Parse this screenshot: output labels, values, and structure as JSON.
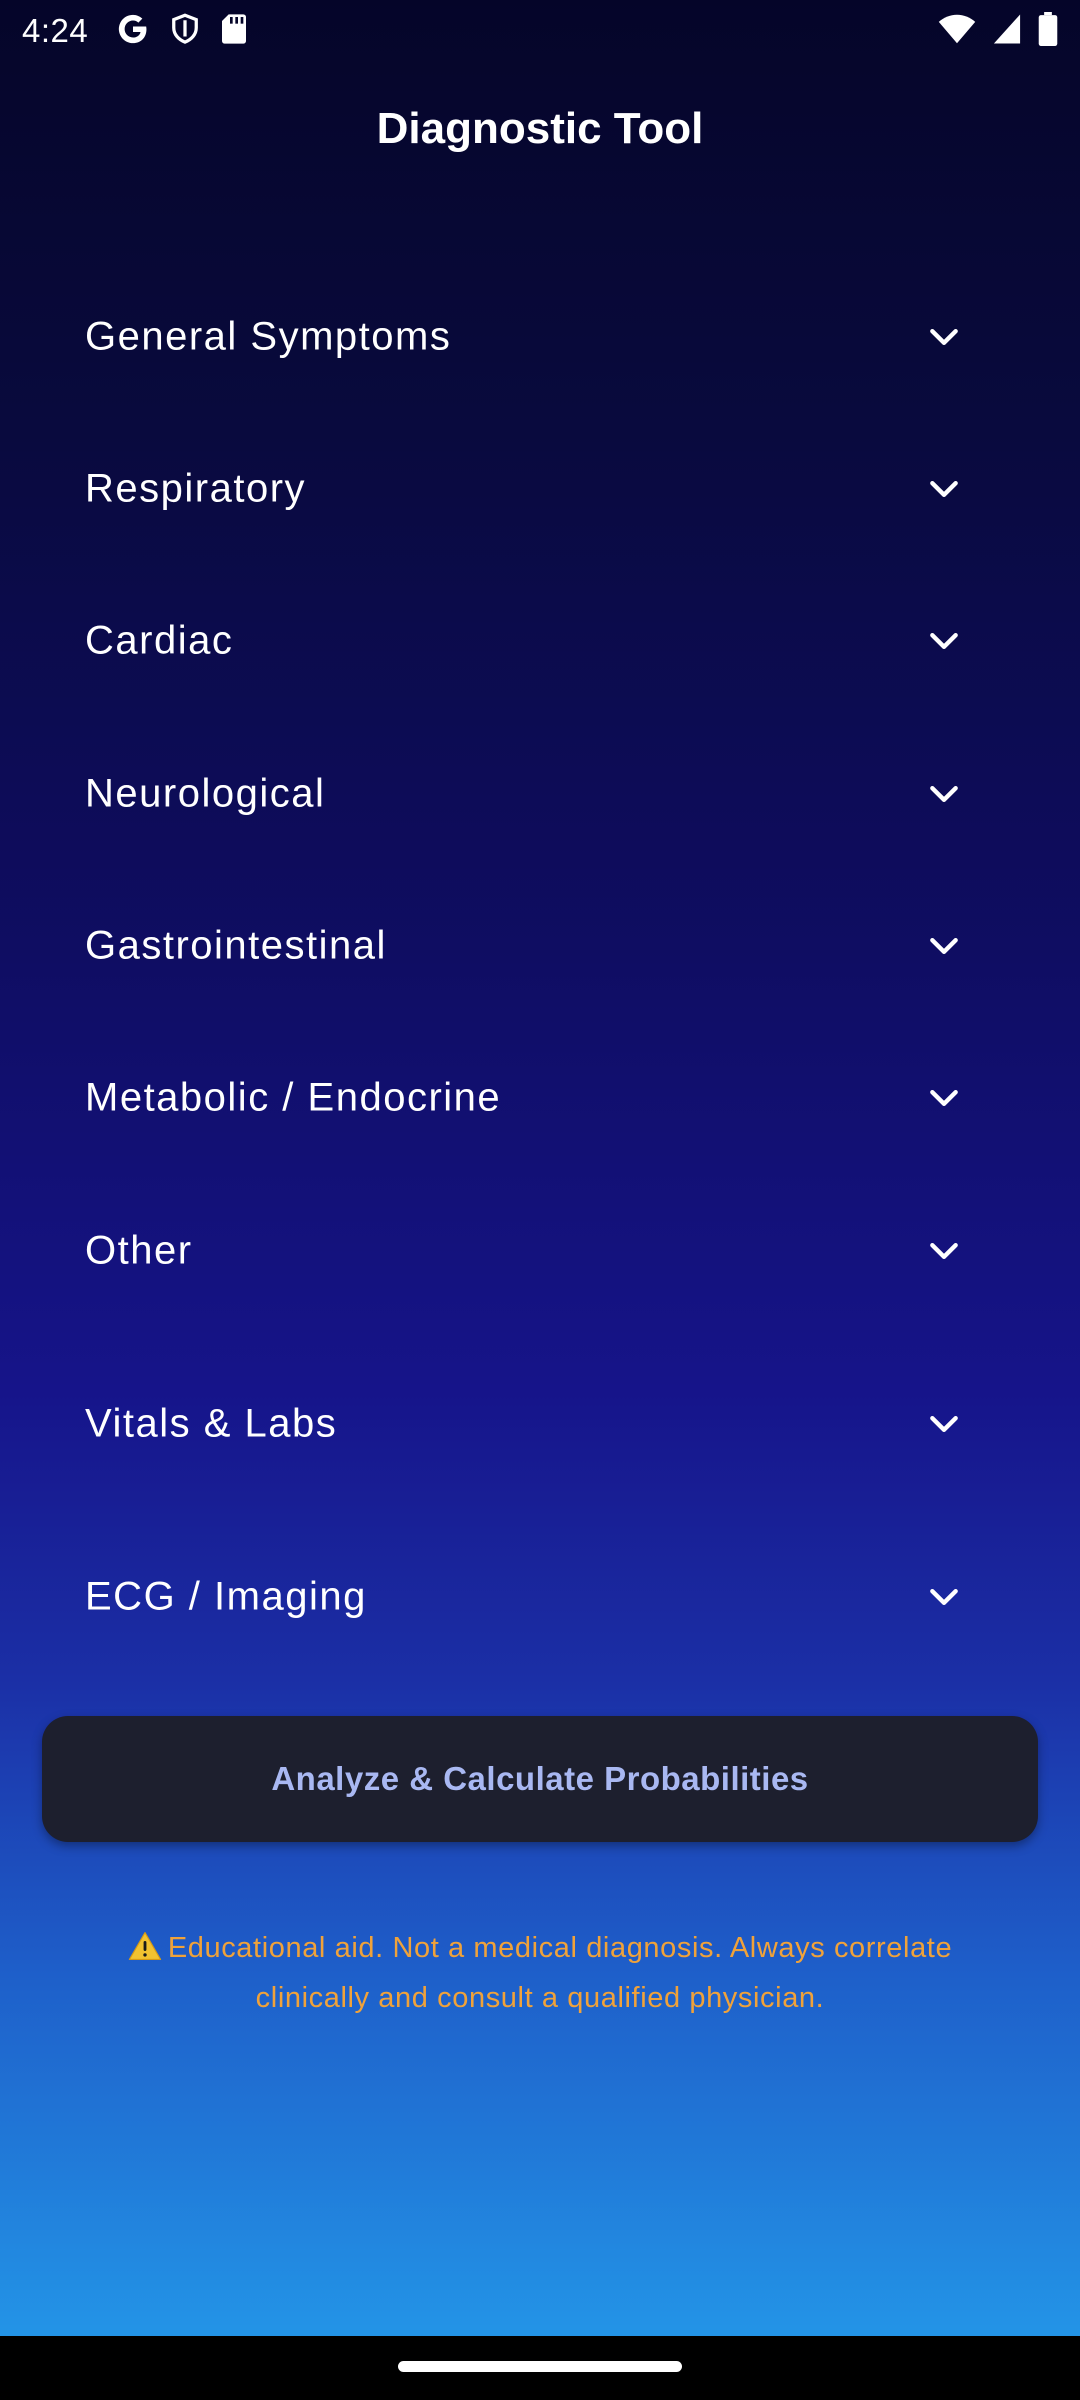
{
  "status_bar": {
    "time": "4:24",
    "left_icons": [
      "google-icon",
      "shield-icon",
      "sd-card-icon"
    ],
    "right_icons": [
      "wifi-icon",
      "cell-signal-icon",
      "battery-icon"
    ]
  },
  "app": {
    "title": "Diagnostic Tool"
  },
  "sections": [
    {
      "label": "General Symptoms",
      "icon": "chevron-down-icon"
    },
    {
      "label": "Respiratory",
      "icon": "chevron-down-icon"
    },
    {
      "label": "Cardiac",
      "icon": "chevron-down-icon"
    },
    {
      "label": "Neurological",
      "icon": "chevron-down-icon"
    },
    {
      "label": "Gastrointestinal",
      "icon": "chevron-down-icon"
    },
    {
      "label": "Metabolic / Endocrine",
      "icon": "chevron-down-icon"
    },
    {
      "label": "Other",
      "icon": "chevron-down-icon"
    },
    {
      "label": "Vitals & Labs",
      "icon": "chevron-down-icon"
    },
    {
      "label": "ECG / Imaging",
      "icon": "chevron-down-icon"
    }
  ],
  "analyze_button": {
    "label": "Analyze & Calculate Probabilities"
  },
  "disclaimer": {
    "icon": "warning-icon",
    "text": "Educational aid. Not a medical diagnosis. Always correlate clinically and consult a qualified physician."
  },
  "colors": {
    "background_top": "#050529",
    "background_bottom": "#2396e8",
    "button_background": "#1d1f2e",
    "button_text": "#a9b8f2",
    "disclaimer_text": "#f0a23a"
  }
}
